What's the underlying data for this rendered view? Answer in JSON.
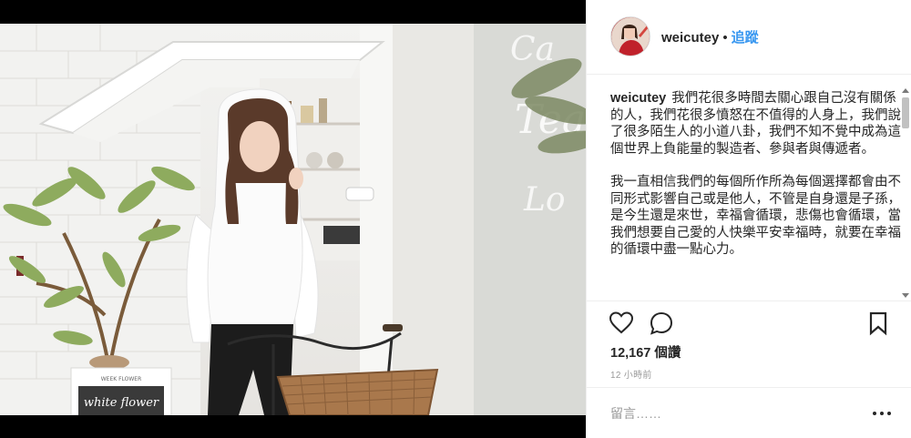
{
  "header": {
    "username": "weicutey",
    "separator": "•",
    "follow_label": "追蹤"
  },
  "caption": {
    "username": "weicutey",
    "paragraph1": "我們花很多時間去關心跟自己沒有關係的人，我們花很多憤怒在不值得的人身上，我們說了很多陌生人的小道八卦，我們不知不覺中成為這個世界上負能量的製造者、參與者與傳遞者。",
    "paragraph2": "我一直相信我們的每個所作所為每個選擇都會由不同形式影響自己或是他人，不管是自身還是子孫，是今生還是來世，幸福會循環，悲傷也會循環，當我們想要自己愛的人快樂平安幸福時，就要在幸福的循環中盡一點心力。"
  },
  "photo": {
    "sign_small": "WEEK FLOWER",
    "sign_script": "white flower",
    "window_text": "Tea"
  },
  "actions": {
    "icons": [
      "heart-icon",
      "comment-icon",
      "bookmark-icon"
    ]
  },
  "likes_text": "12,167 個讚",
  "time_text": "12 小時前",
  "comment": {
    "placeholder": "留言……"
  },
  "colors": {
    "link_blue": "#3897f0",
    "text": "#262626",
    "muted": "#999999",
    "border": "#efefef"
  }
}
